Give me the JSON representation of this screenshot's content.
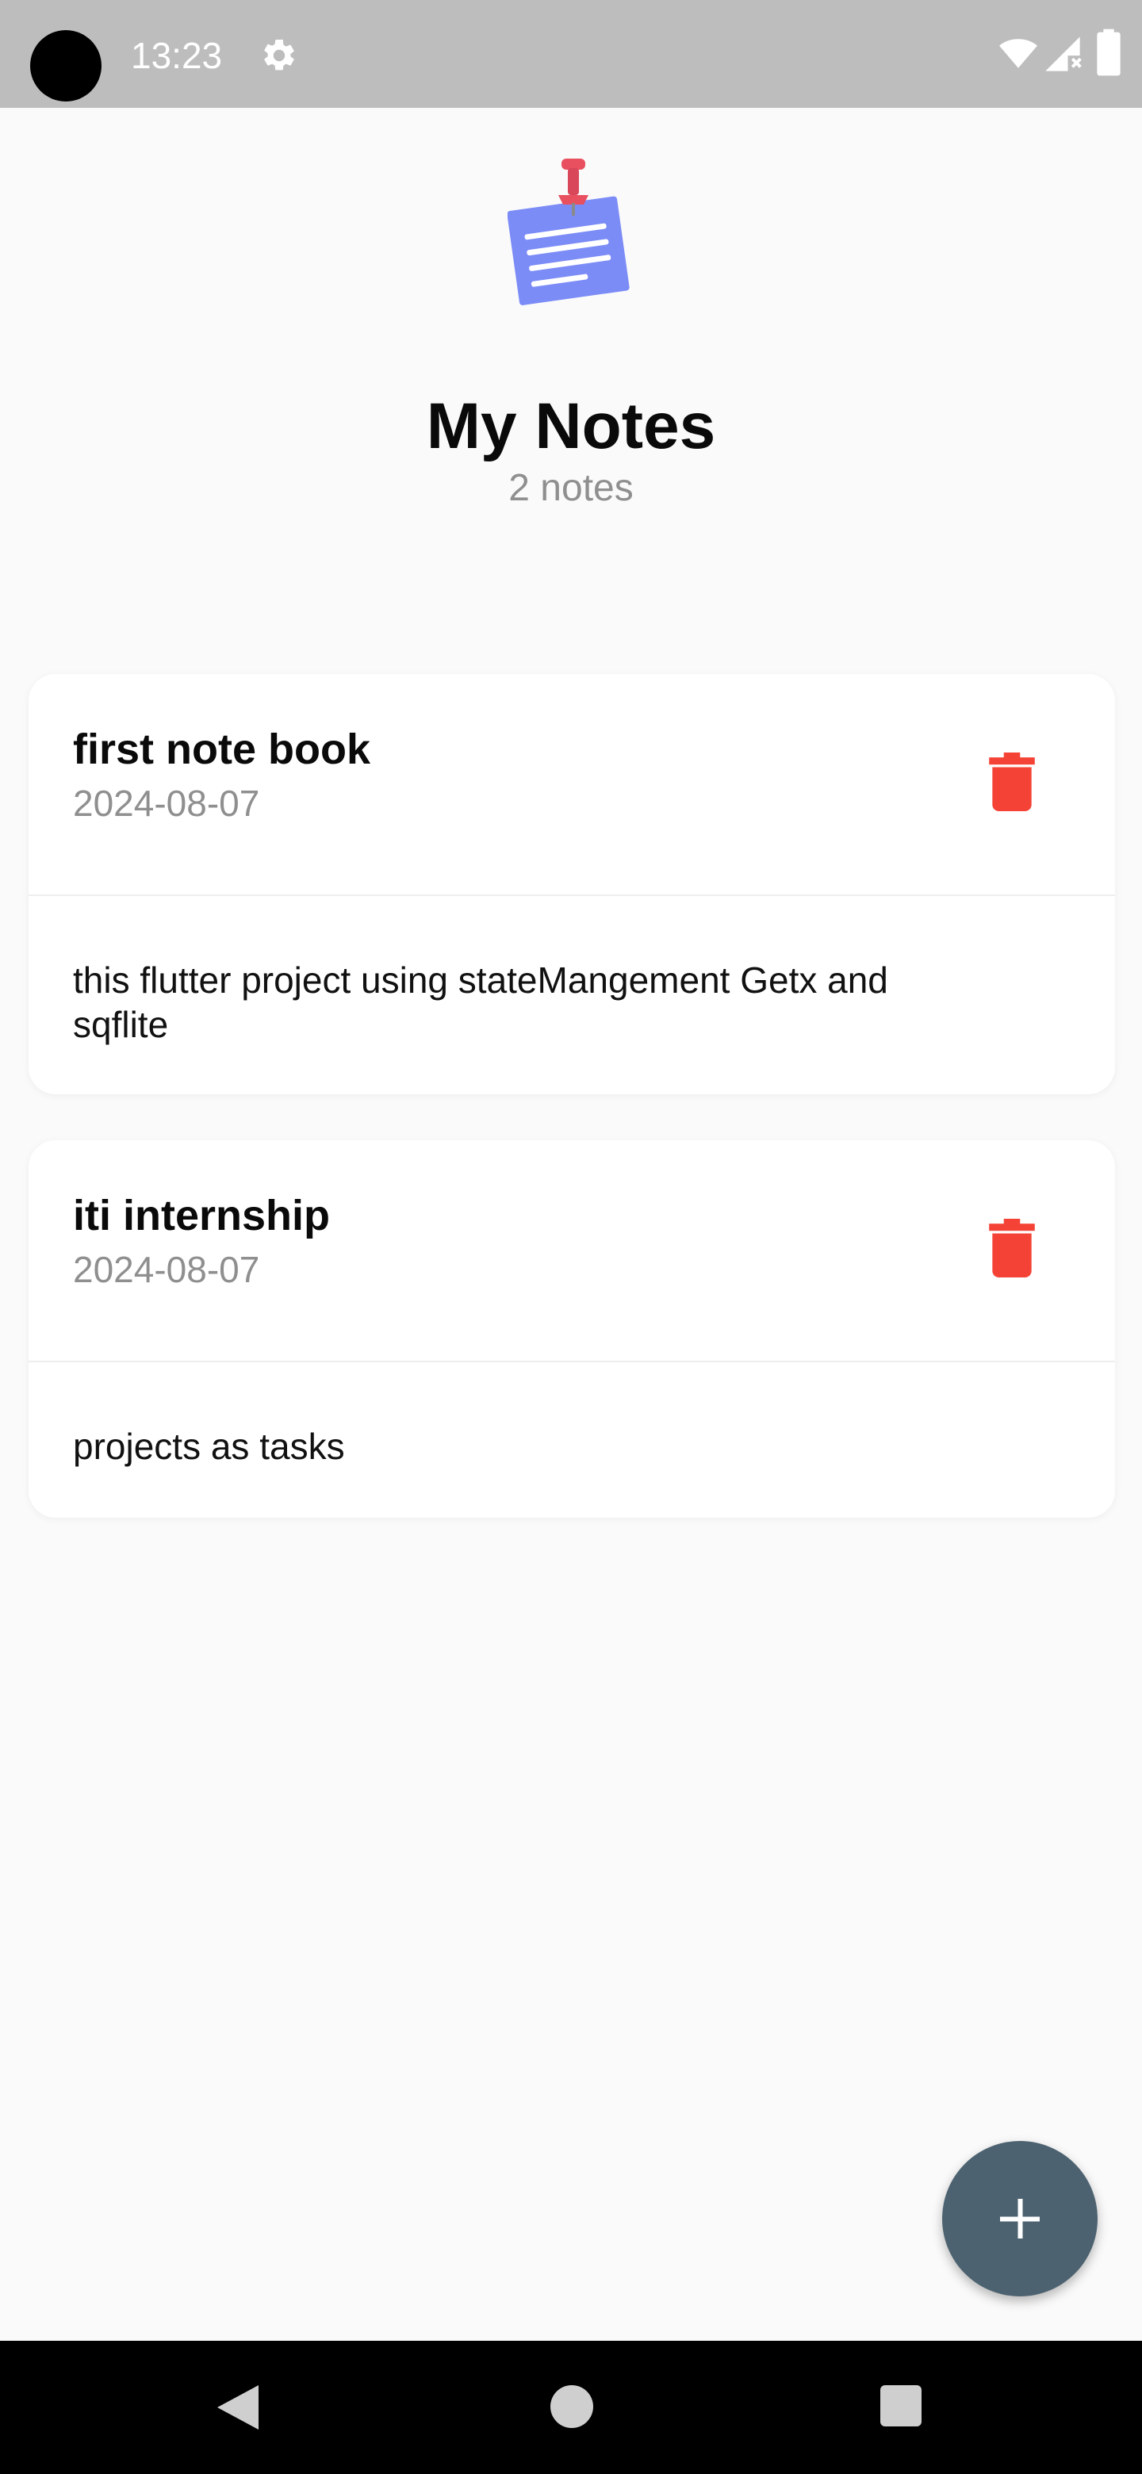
{
  "status_bar": {
    "time": "13:23"
  },
  "header": {
    "title": "My Notes",
    "count": "2 notes"
  },
  "notes": [
    {
      "title": "first note book",
      "date": "2024-08-07",
      "body": "this flutter  project  using stateMangement Getx and sqflite"
    },
    {
      "title": "iti internship",
      "date": "2024-08-07",
      "body": "projects as tasks"
    }
  ],
  "icons": {
    "delete": "trash-icon",
    "add": "plus-icon"
  },
  "colors": {
    "delete": "#f44336",
    "fab": "#4d6270",
    "logo_note": "#7b8cf7",
    "pin": "#e85060"
  }
}
